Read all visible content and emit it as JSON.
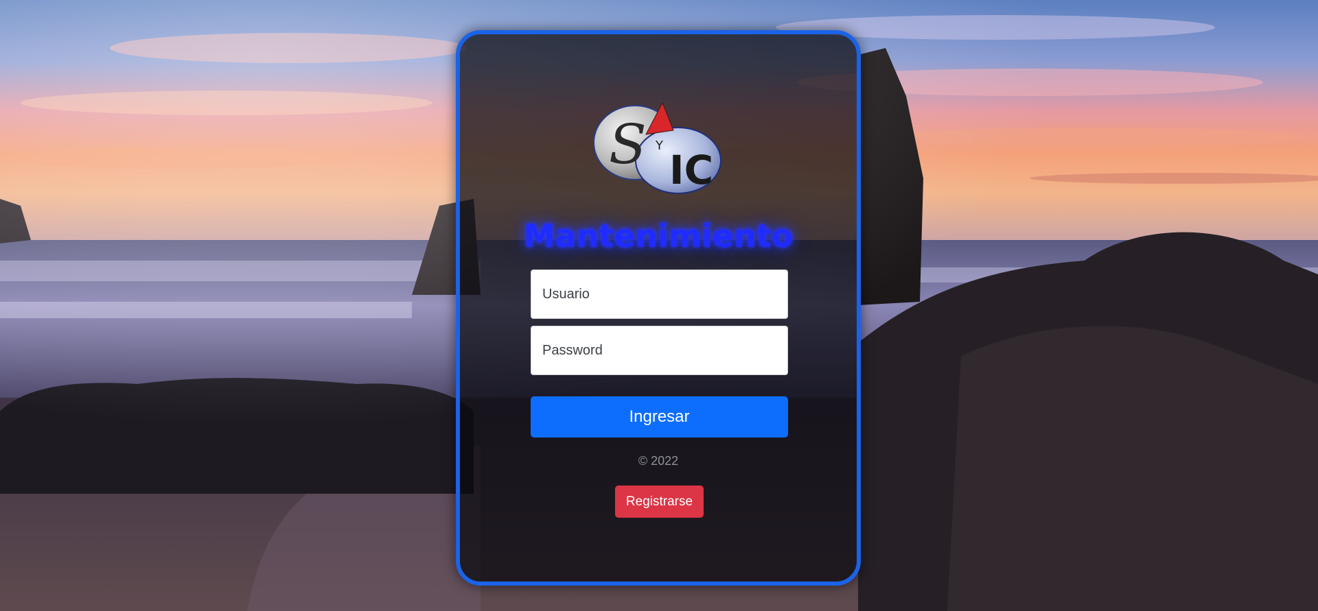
{
  "page": {
    "title": "Mantenimiento",
    "background": "beach-sunset-photo"
  },
  "logo": {
    "icon": "syic-logo",
    "letters": [
      "S",
      "Y",
      "IC"
    ]
  },
  "form": {
    "username": {
      "placeholder": "Usuario",
      "value": ""
    },
    "password": {
      "placeholder": "Password",
      "value": ""
    },
    "submit_label": "Ingresar"
  },
  "footer": {
    "copyright": "© 2022",
    "register_label": "Registrarse"
  },
  "colors": {
    "card_border": "#1b63e8",
    "title": "#1f2bff",
    "primary_button": "#0d6efd",
    "danger_button": "#dc3545"
  }
}
